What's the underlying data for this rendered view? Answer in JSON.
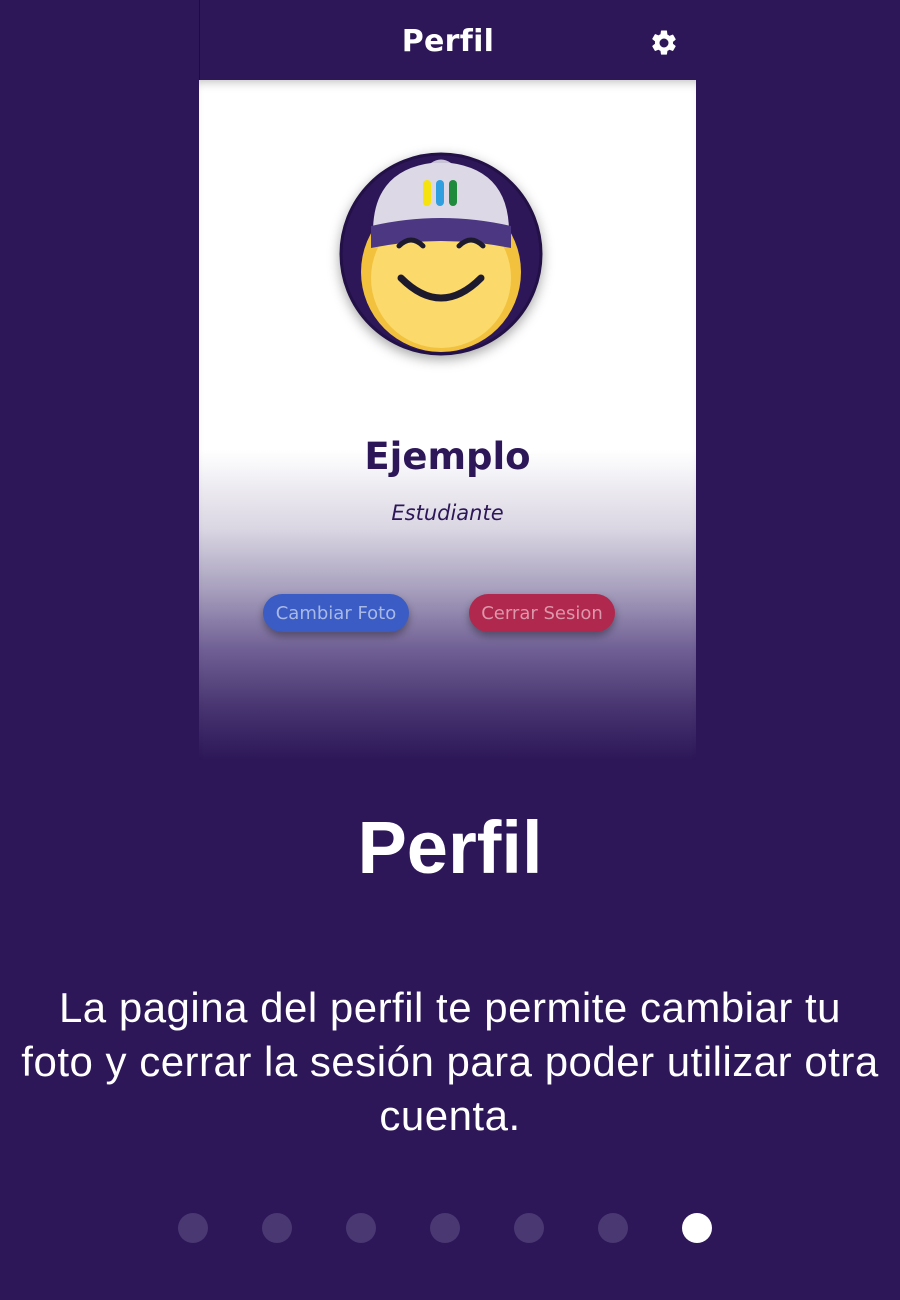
{
  "app": {
    "header_title": "Perfil",
    "settings_icon": "gear-icon"
  },
  "profile": {
    "avatar_icon": "smiley-cap-avatar",
    "name": "Ejemplo",
    "role": "Estudiante",
    "change_photo_label": "Cambiar Foto",
    "logout_label": "Cerrar Sesion"
  },
  "onboarding": {
    "title": "Perfil",
    "description": "La pagina del perfil te permite cambiar tu foto y cerrar la sesión para poder utilizar otra cuenta.",
    "page_count": 7,
    "current_page": 7
  },
  "colors": {
    "background": "#2d1758",
    "change_photo_button": "#3a5cc4",
    "logout_button": "#b0284d",
    "active_dot": "#ffffff",
    "inactive_dot": "#4a3872"
  }
}
